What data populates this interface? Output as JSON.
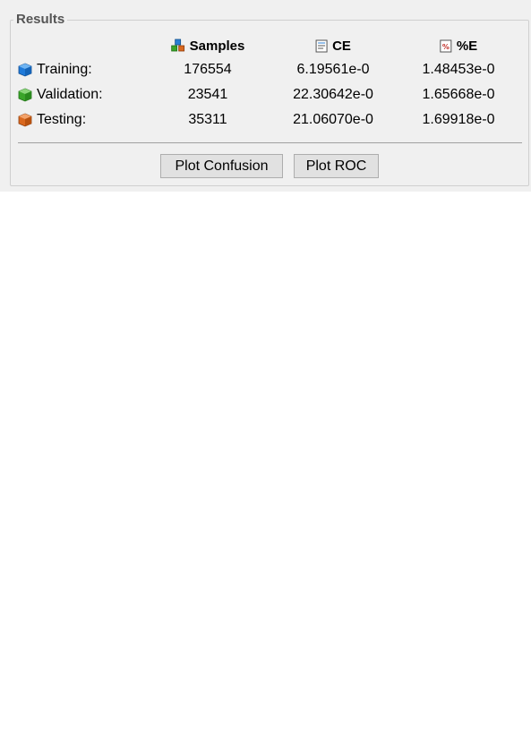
{
  "group_title": "Results",
  "columns": {
    "samples": {
      "label": "Samples",
      "icon": "cubes-icon"
    },
    "ce": {
      "label": "CE",
      "icon": "document-icon"
    },
    "pe": {
      "label": "%E",
      "icon": "percent-icon"
    }
  },
  "rows": [
    {
      "label": "Training:",
      "icon": "blue-cube-icon",
      "color": "#1f7ad9",
      "samples": "176554",
      "ce": "6.19561e-0",
      "pe": "1.48453e-0"
    },
    {
      "label": "Validation:",
      "icon": "green-cube-icon",
      "color": "#3aa52a",
      "samples": "23541",
      "ce": "22.30642e-0",
      "pe": "1.65668e-0"
    },
    {
      "label": "Testing:",
      "icon": "orange-cube-icon",
      "color": "#d9681e",
      "samples": "35311",
      "ce": "21.06070e-0",
      "pe": "1.69918e-0"
    }
  ],
  "buttons": {
    "plot_confusion": "Plot Confusion",
    "plot_roc": "Plot ROC"
  }
}
